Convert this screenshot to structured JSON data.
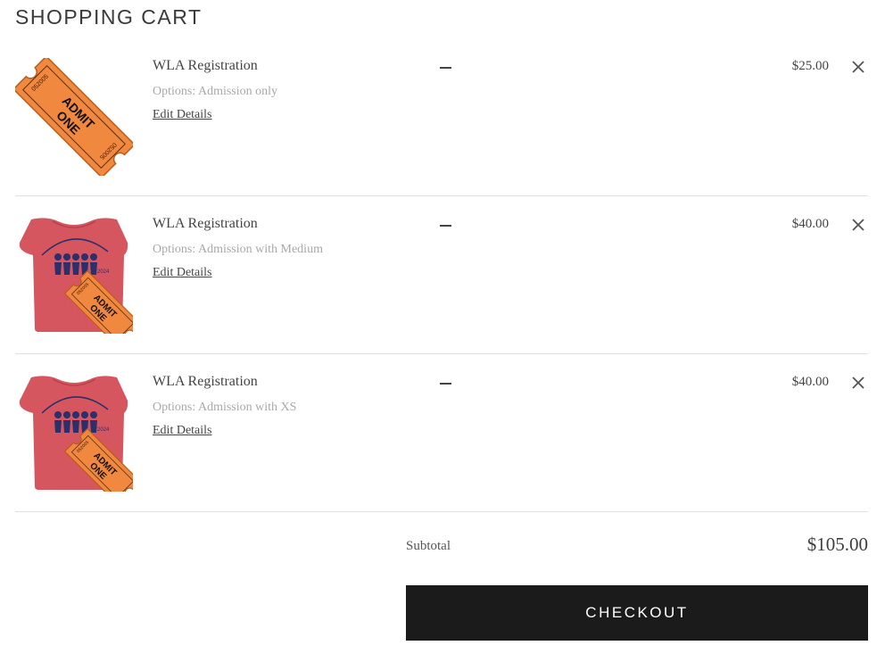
{
  "page_title": "SHOPPING CART",
  "items": [
    {
      "name": "WLA Registration",
      "options": "Options: Admission only",
      "edit_label": "Edit Details",
      "price": "$25.00",
      "thumbnail": "ticket-icon",
      "ticket_text": [
        "ADMIT",
        "ONE"
      ],
      "ticket_number": "052005"
    },
    {
      "name": "WLA Registration",
      "options": "Options: Admission with Medium",
      "edit_label": "Edit Details",
      "price": "$40.00",
      "thumbnail": "tshirt-ticket-icon",
      "ticket_text": [
        "ADMIT",
        "ONE"
      ],
      "ticket_number": "052005",
      "shirt_year": "2024"
    },
    {
      "name": "WLA Registration",
      "options": "Options: Admission with XS",
      "edit_label": "Edit Details",
      "price": "$40.00",
      "thumbnail": "tshirt-ticket-icon",
      "ticket_text": [
        "ADMIT",
        "ONE"
      ],
      "ticket_number": "052005",
      "shirt_year": "2024"
    }
  ],
  "summary": {
    "subtotal_label": "Subtotal",
    "subtotal_value": "$105.00",
    "checkout_label": "CHECKOUT"
  },
  "colors": {
    "ticket_orange": "#f0883f",
    "ticket_border": "#b85d1c",
    "shirt_red": "#d65660",
    "checkout_bg": "#1b1b1b",
    "divider": "#e1e1e1"
  }
}
